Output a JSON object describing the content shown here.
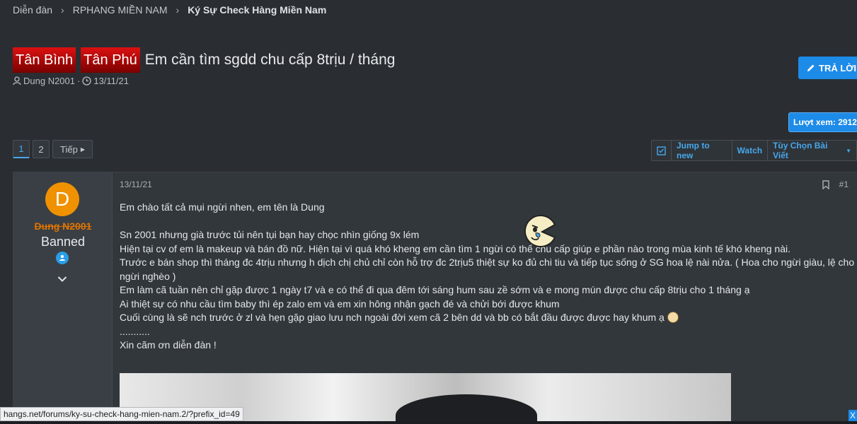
{
  "breadcrumb": {
    "items": [
      "Diễn đàn",
      "RPHANG MIỀN NAM",
      "Ký Sự Check Hàng Miền Nam"
    ]
  },
  "thread": {
    "prefixes": [
      "Tân Bình",
      "Tân Phú"
    ],
    "title": "Em cần tìm sgdd chu cấp 8trịu / tháng",
    "author": "Dung N2001",
    "date": "13/11/21",
    "separator": "·"
  },
  "actions": {
    "reply_label": "TRẢ LỜI",
    "views_label": "Lượt xem: 2912"
  },
  "pagination": {
    "pages": [
      "1",
      "2"
    ],
    "next_label": "Tiếp"
  },
  "toolbar": {
    "jump_label": "Jump to new",
    "watch_label": "Watch",
    "options_label": "Tùy Chọn Bài Viết"
  },
  "post": {
    "user": {
      "avatar_letter": "D",
      "name": "Dung N2001",
      "title": "Banned"
    },
    "date": "13/11/21",
    "number": "#1",
    "lines": [
      "Em chào tất cả mụi ngừi nhen, em tên là Dung",
      "",
      "Sn 2001 nhưng già trước tủi nên tụi bạn hay chọc nhìn giống 9x lém",
      "Hiện tại cv of em là makeup và bán đồ nữ. Hiện tại vì quá khó kheng em cần tìm 1 ngừi có thể chu cấp giúp e phần nào trong mùa kinh tế khó kheng nài.",
      "Trước e bán shop thì tháng đc 4trịu nhưng h dịch chị chủ chỉ còn hỗ trợ đc 2trịu5 thiệt sự ko đủ chi tiu và tiếp tục sống ở SG hoa lệ nài nửa. ( Hoa cho ngừi giàu, lệ cho",
      "ngừi nghèo )",
      "Em làm cã tuần nên chỉ gặp được 1 ngày t7 và e có thể đi qua đêm tới sáng hum sau zề sớm và e mong mún được chu cấp 8trịu cho 1 tháng ạ",
      "Ai thiệt sự có nhu cầu tìm baby thì ép zalo em và em xin hông nhận gạch đé và chửi bới được khum",
      "Cuối cùng là sẽ nch trước ở zl và hẹn gặp giao lưu nch ngoài đời xem cã 2 bên dd và bb có bắt đầu được được hay khum ạ",
      "...........",
      "Xin cãm ơn diễn đàn !"
    ]
  },
  "status": {
    "url": "hangs.net/forums/ky-su-check-hang-mien-nam.2/?prefix_id=49",
    "close": "X"
  },
  "colors": {
    "accent": "#1d8be8",
    "background": "#2a2e33",
    "username": "#e07400"
  }
}
